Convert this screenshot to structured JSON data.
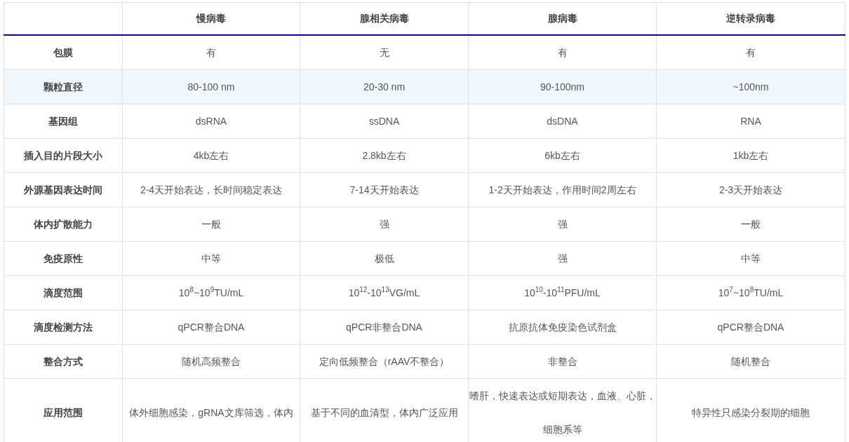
{
  "table": {
    "columns": [
      "",
      "慢病毒",
      "腺相关病毒",
      "腺病毒",
      "逆转录病毒"
    ],
    "rows": [
      {
        "selected": false,
        "cells": [
          "包膜",
          "有",
          "无",
          "有",
          "有"
        ]
      },
      {
        "selected": true,
        "cells": [
          "颗粒直径",
          "80-100 nm",
          "20-30 nm",
          "90-100nm",
          "~100nm"
        ]
      },
      {
        "selected": false,
        "cells": [
          "基因组",
          "dsRNA",
          "ssDNA",
          "dsDNA",
          "RNA"
        ]
      },
      {
        "selected": false,
        "cells": [
          "插入目的片段大小",
          "4kb左右",
          "2.8kb左右",
          "6kb左右",
          "1kb左右"
        ]
      },
      {
        "selected": false,
        "cells": [
          "外源基因表达时间",
          "2-4天开始表达，长时间稳定表达",
          "7-14天开始表达",
          "1-2天开始表达，作用时间2周左右",
          "2-3天开始表达"
        ]
      },
      {
        "selected": false,
        "cells": [
          "体内扩散能力",
          "一般",
          "强",
          "强",
          "一般"
        ]
      },
      {
        "selected": false,
        "cells": [
          "免疫原性",
          "中等",
          "极低",
          "强",
          "中等"
        ]
      },
      {
        "selected": false,
        "cells": [
          "滴度范围",
          "10$^{8}$~10$^{9}$TU/mL",
          "10$^{12}$-10$^{13}$VG/mL",
          "10$^{10}$-10$^{11}$PFU/mL",
          "10$^{7}$~10$^{8}$TU/mL"
        ]
      },
      {
        "selected": false,
        "cells": [
          "滴度检测方法",
          "qPCR整合DNA",
          "qPCR非整合DNA",
          "抗原抗体免疫染色试剂盒",
          "qPCR整合DNA"
        ]
      },
      {
        "selected": false,
        "cells": [
          "整合方式",
          "随机高频整合",
          "定向低频整合（rAAV不整合）",
          "非整合",
          "随机整合"
        ]
      },
      {
        "selected": false,
        "cells": [
          "应用范围",
          "体外细胞感染，gRNA文库筛选，体内",
          "基于不同的血清型，体内广泛应用",
          "嗜肝，快速表达或短期表达，血液、心脏，细胞系等",
          "特异性只感染分裂期的细胞"
        ]
      }
    ]
  }
}
